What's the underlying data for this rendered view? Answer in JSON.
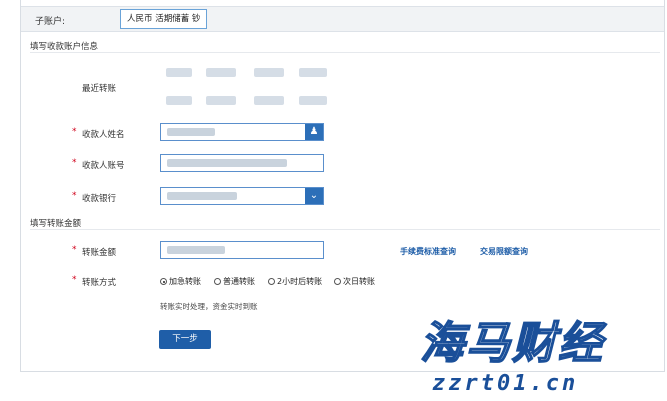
{
  "sub_account": {
    "label": "子账户:",
    "value": "人民币 活期储蓄 钞"
  },
  "payee_section": {
    "title": "填写收款账户信息",
    "recent_label": "最近转账",
    "name_label": "收款人姓名",
    "account_label": "收款人账号",
    "bank_label": "收款银行",
    "required_mark": "*",
    "name_icon": "user-icon",
    "bank_icon": "chevron-down-icon"
  },
  "amount_section": {
    "title": "填写转账金额",
    "amount_label": "转账金额",
    "method_label": "转账方式",
    "fee_link": "手续费标准查询",
    "limit_link": "交易限额查询",
    "methods": [
      {
        "label": "加急转账",
        "selected": true
      },
      {
        "label": "普通转账",
        "selected": false
      },
      {
        "label": "2小时后转账",
        "selected": false
      },
      {
        "label": "次日转账",
        "selected": false
      }
    ],
    "note": "转账实时处理，资金实时到账"
  },
  "next_button": "下一步",
  "watermark": {
    "brand": "海马财经",
    "url": "zzrt01.cn"
  },
  "colors": {
    "accent": "#1f5ea8",
    "required": "#d0021b",
    "input_border": "#5a8fcc"
  }
}
